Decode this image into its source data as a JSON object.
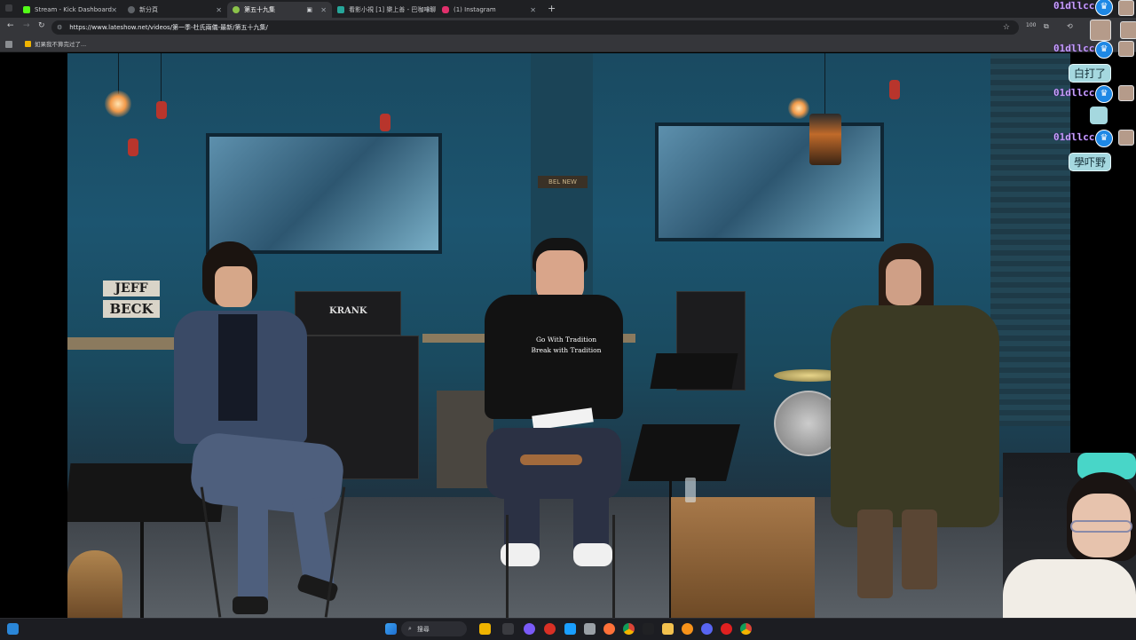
{
  "browser": {
    "tabs": [
      {
        "title": "Stream - Kick Dashboard",
        "favicon_color": "#53fc18",
        "active": false
      },
      {
        "title": "新分頁",
        "favicon_color": "#c8c9cc",
        "active": false
      },
      {
        "title": "第五十九集",
        "favicon_color": "#8bc34a",
        "active": true
      },
      {
        "title": "看影小視 [1] 樂上善 - 巴咖啡聊",
        "favicon_color": "#26a69a",
        "active": false
      },
      {
        "title": "(1) Instagram",
        "favicon_color": "#e1306c",
        "active": false
      }
    ],
    "new_tab": "+",
    "url": "https://www.lateshow.net/videos/第一季-杜氏兩儀-最新/第五十九集/",
    "extension_badge": "100",
    "bookmarks": [
      {
        "label": "如果我不算完过了..."
      }
    ]
  },
  "stream_chat": [
    {
      "user": "01dllcc"
    },
    {
      "user": "01dllcc"
    },
    {
      "message": "白打了"
    },
    {
      "user": "01dllcc"
    },
    {
      "user": "01dllcc"
    },
    {
      "message": "學吓野"
    }
  ],
  "video": {
    "sign_top": "JEFF",
    "sign_bottom": "BECK",
    "shirt_line1": "Go With Tradition",
    "shirt_line2": "Break with Tradition",
    "amp_brand": "KRANK",
    "wall_sign": "BEL NEW"
  },
  "taskbar": {
    "search_label": "搜尋"
  },
  "colors": {
    "chat_username": "#d8b8ff",
    "chat_bubble": "#a5d8df",
    "crown_badge": "#1e88e5"
  }
}
